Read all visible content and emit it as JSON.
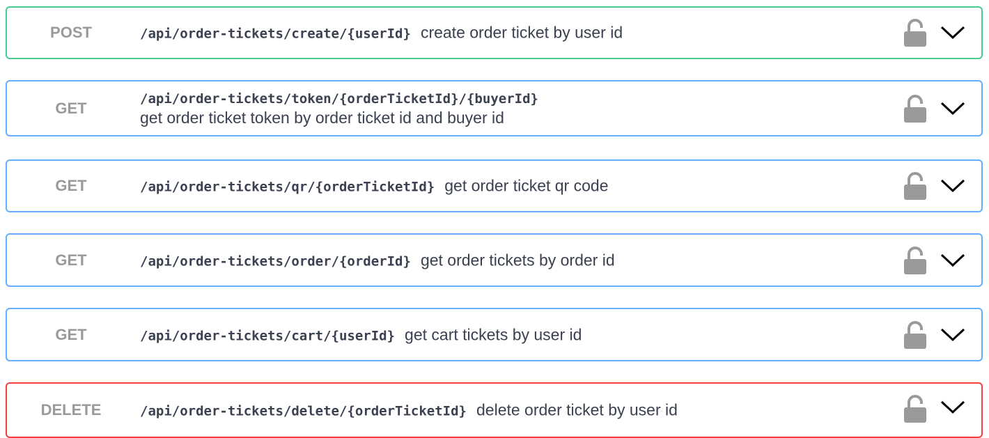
{
  "operations": [
    {
      "method": "POST",
      "path": "/api/order-tickets/create/{userId}",
      "description": "create order ticket by user id",
      "style": "post",
      "lock_icon": "unlocked-padlock-icon",
      "toggle_icon": "chevron-down-icon"
    },
    {
      "method": "GET",
      "path": "/api/order-tickets/token/{orderTicketId}/{buyerId}",
      "description": "get order ticket token by order ticket id and buyer id",
      "style": "get",
      "lock_icon": "unlocked-padlock-icon",
      "toggle_icon": "chevron-down-icon"
    },
    {
      "method": "GET",
      "path": "/api/order-tickets/qr/{orderTicketId}",
      "description": "get order ticket qr code",
      "style": "get",
      "lock_icon": "unlocked-padlock-icon",
      "toggle_icon": "chevron-down-icon"
    },
    {
      "method": "GET",
      "path": "/api/order-tickets/order/{orderId}",
      "description": "get order tickets by order id",
      "style": "get",
      "lock_icon": "unlocked-padlock-icon",
      "toggle_icon": "chevron-down-icon"
    },
    {
      "method": "GET",
      "path": "/api/order-tickets/cart/{userId}",
      "description": "get cart tickets by user id",
      "style": "get",
      "lock_icon": "unlocked-padlock-icon",
      "toggle_icon": "chevron-down-icon"
    },
    {
      "method": "DELETE",
      "path": "/api/order-tickets/delete/{orderTicketId}",
      "description": "delete order ticket by user id",
      "style": "delete",
      "lock_icon": "unlocked-padlock-icon",
      "toggle_icon": "chevron-down-icon"
    }
  ],
  "colors": {
    "post": "#49cc90",
    "get": "#61affe",
    "delete": "#f93e3e",
    "method_text": "#9a9a9a",
    "text": "#3b4151",
    "icon": "#9a9a9a"
  }
}
